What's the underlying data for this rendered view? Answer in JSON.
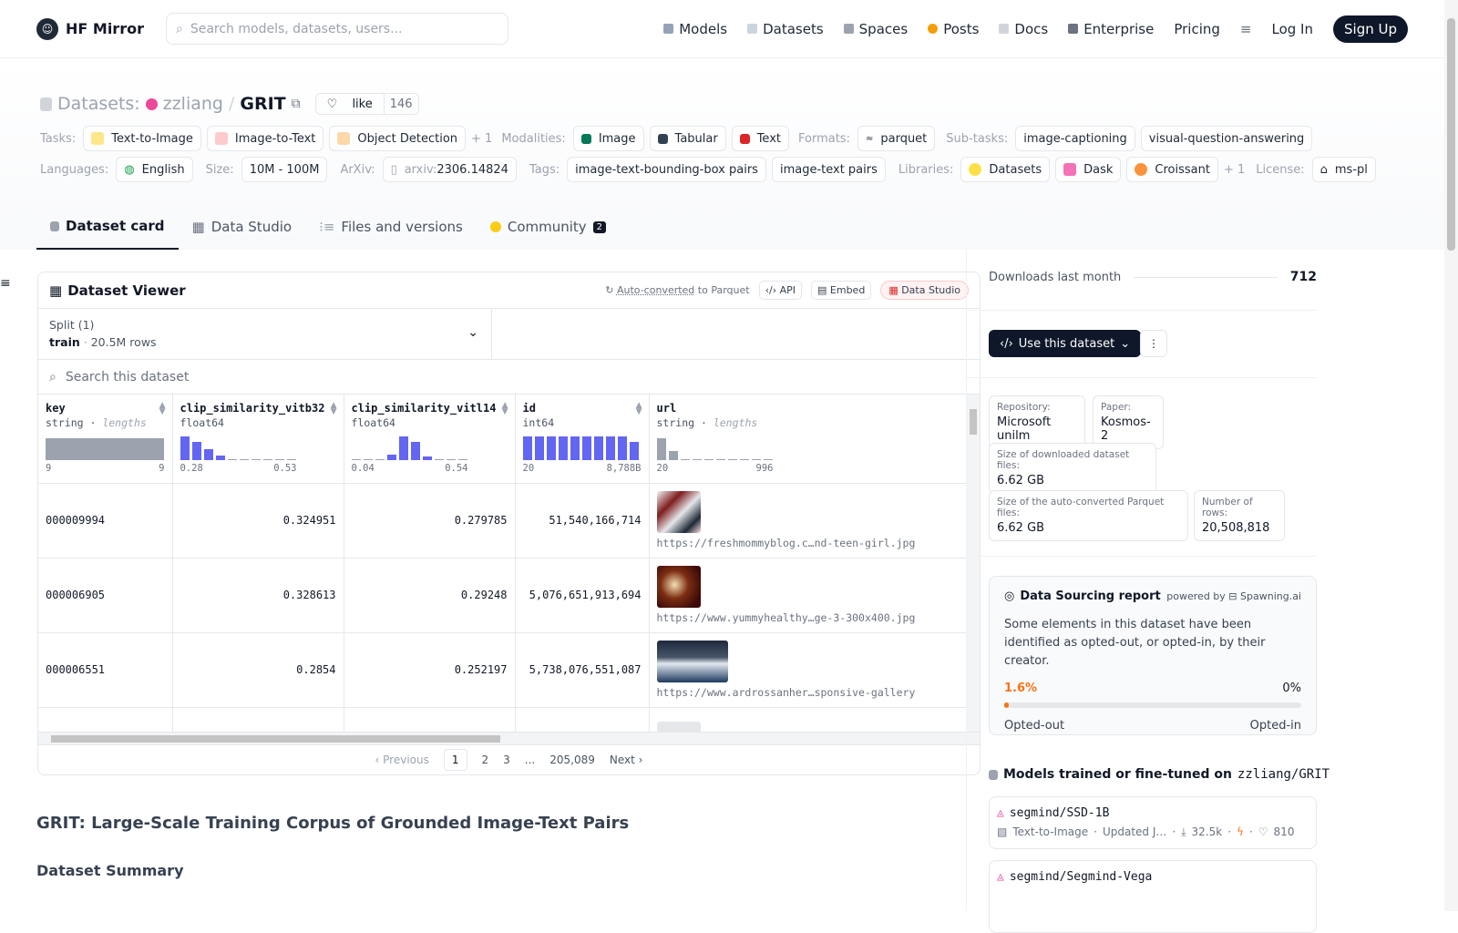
{
  "nav": {
    "brand": "HF Mirror",
    "search_placeholder": "Search models, datasets, users...",
    "links": [
      "Models",
      "Datasets",
      "Spaces",
      "Posts",
      "Docs",
      "Enterprise",
      "Pricing"
    ],
    "login": "Log In",
    "signup": "Sign Up"
  },
  "header": {
    "prefix": "Datasets:",
    "owner": "zzliang",
    "slash": "/",
    "name": "GRIT",
    "like_label": "like",
    "like_count": "146"
  },
  "tags": {
    "tasks_label": "Tasks:",
    "tasks": [
      "Text-to-Image",
      "Image-to-Text",
      "Object Detection"
    ],
    "tasks_more": "+ 1",
    "modalities_label": "Modalities:",
    "modalities": [
      "Image",
      "Tabular",
      "Text"
    ],
    "formats_label": "Formats:",
    "formats": [
      "parquet"
    ],
    "subtasks_label": "Sub-tasks:",
    "subtasks": [
      "image-captioning",
      "visual-question-answering"
    ],
    "languages_label": "Languages:",
    "languages": [
      "English"
    ],
    "size_label": "Size:",
    "size": "10M - 100M",
    "arxiv_label": "ArXiv:",
    "arxiv_prefix": "arxiv:",
    "arxiv_id": "2306.14824",
    "tags_label": "Tags:",
    "tag_items": [
      "image-text-bounding-box pairs",
      "image-text pairs"
    ],
    "libraries_label": "Libraries:",
    "libraries": [
      "Datasets",
      "Dask",
      "Croissant"
    ],
    "libraries_more": "+ 1",
    "license_label": "License:",
    "license": "ms-pl"
  },
  "tabs": [
    "Dataset card",
    "Data Studio",
    "Files and versions",
    "Community"
  ],
  "community_count": "2",
  "viewer": {
    "title": "Dataset Viewer",
    "autoconv": "Auto-converted",
    "autoconv_suffix": "to Parquet",
    "api": "API",
    "embed": "Embed",
    "studio": "Data Studio",
    "split_label": "Split (1)",
    "split_name": "train",
    "split_dot": "·",
    "split_rows": "20.5M rows",
    "search_placeholder": "Search this dataset",
    "columns": [
      {
        "name": "key",
        "type": "string",
        "extra": "lengths",
        "min": "9",
        "max": "9"
      },
      {
        "name": "clip_similarity_vitb32",
        "type": "float64",
        "extra": "",
        "min": "0.28",
        "max": "0.53"
      },
      {
        "name": "clip_similarity_vitl14",
        "type": "float64",
        "extra": "",
        "min": "0.04",
        "max": "0.54"
      },
      {
        "name": "id",
        "type": "int64",
        "extra": "",
        "min": "20",
        "max": "8,788B"
      },
      {
        "name": "url",
        "type": "string",
        "extra": "lengths",
        "min": "20",
        "max": "996"
      }
    ],
    "rows": [
      {
        "key": "000009994",
        "vitb32": "0.324951",
        "vitl14": "0.279785",
        "id": "51,540,166,714",
        "url": "https://freshmommyblog.c…nd-teen-girl.jpg"
      },
      {
        "key": "000006905",
        "vitb32": "0.328613",
        "vitl14": "0.29248",
        "id": "5,076,651,913,694",
        "url": "https://www.yummyhealthy…ge-3-300x400.jpg"
      },
      {
        "key": "000006551",
        "vitb32": "0.2854",
        "vitl14": "0.252197",
        "id": "5,738,076,551,087",
        "url": "https://www.ardrossanher…sponsive-gallery"
      }
    ],
    "pager": {
      "prev": "Previous",
      "pages": [
        "1",
        "2",
        "3",
        "...",
        "205,089"
      ],
      "next": "Next"
    }
  },
  "card": {
    "heading": "GRIT: Large-Scale Training Corpus of Grounded Image-Text Pairs",
    "summary_heading": "Dataset Summary"
  },
  "sidebar": {
    "downloads_label": "Downloads last month",
    "downloads": "712",
    "use_button": "Use this dataset",
    "repository_label": "Repository:",
    "repository": "Microsoft unilm",
    "paper_label": "Paper:",
    "paper": "Kosmos-2",
    "dl_size_label": "Size of downloaded dataset files:",
    "dl_size": "6.62 GB",
    "parquet_size_label": "Size of the auto-converted Parquet files:",
    "parquet_size": "6.62 GB",
    "rows_label": "Number of rows:",
    "rows": "20,508,818",
    "report_title": "Data Sourcing report",
    "powered_by": "powered by",
    "powered_name": "Spawning.ai",
    "report_text": "Some elements in this dataset have been identified as opted-out, or opted-in, by their creator.",
    "opted_out_pct": "1.6%",
    "opted_in_pct": "0%",
    "opted_out_fraction": 0.016,
    "opted_out_label": "Opted-out",
    "opted_in_label": "Opted-in",
    "models_heading": "Models trained or fine-tuned on",
    "models_repo": "zzliang/GRIT",
    "models": [
      {
        "name": "segmind/SSD-1B",
        "task": "Text-to-Image",
        "updated": "Updated J…",
        "downloads": "32.5k",
        "likes": "810"
      },
      {
        "name": "segmind/Segmind-Vega",
        "task": "",
        "updated": "",
        "downloads": "",
        "likes": ""
      }
    ]
  },
  "colors": {
    "accent": "#6366f1",
    "primary_dark": "#0f172a",
    "opt_out": "#f97316",
    "owner_dot": "#ec4899"
  }
}
